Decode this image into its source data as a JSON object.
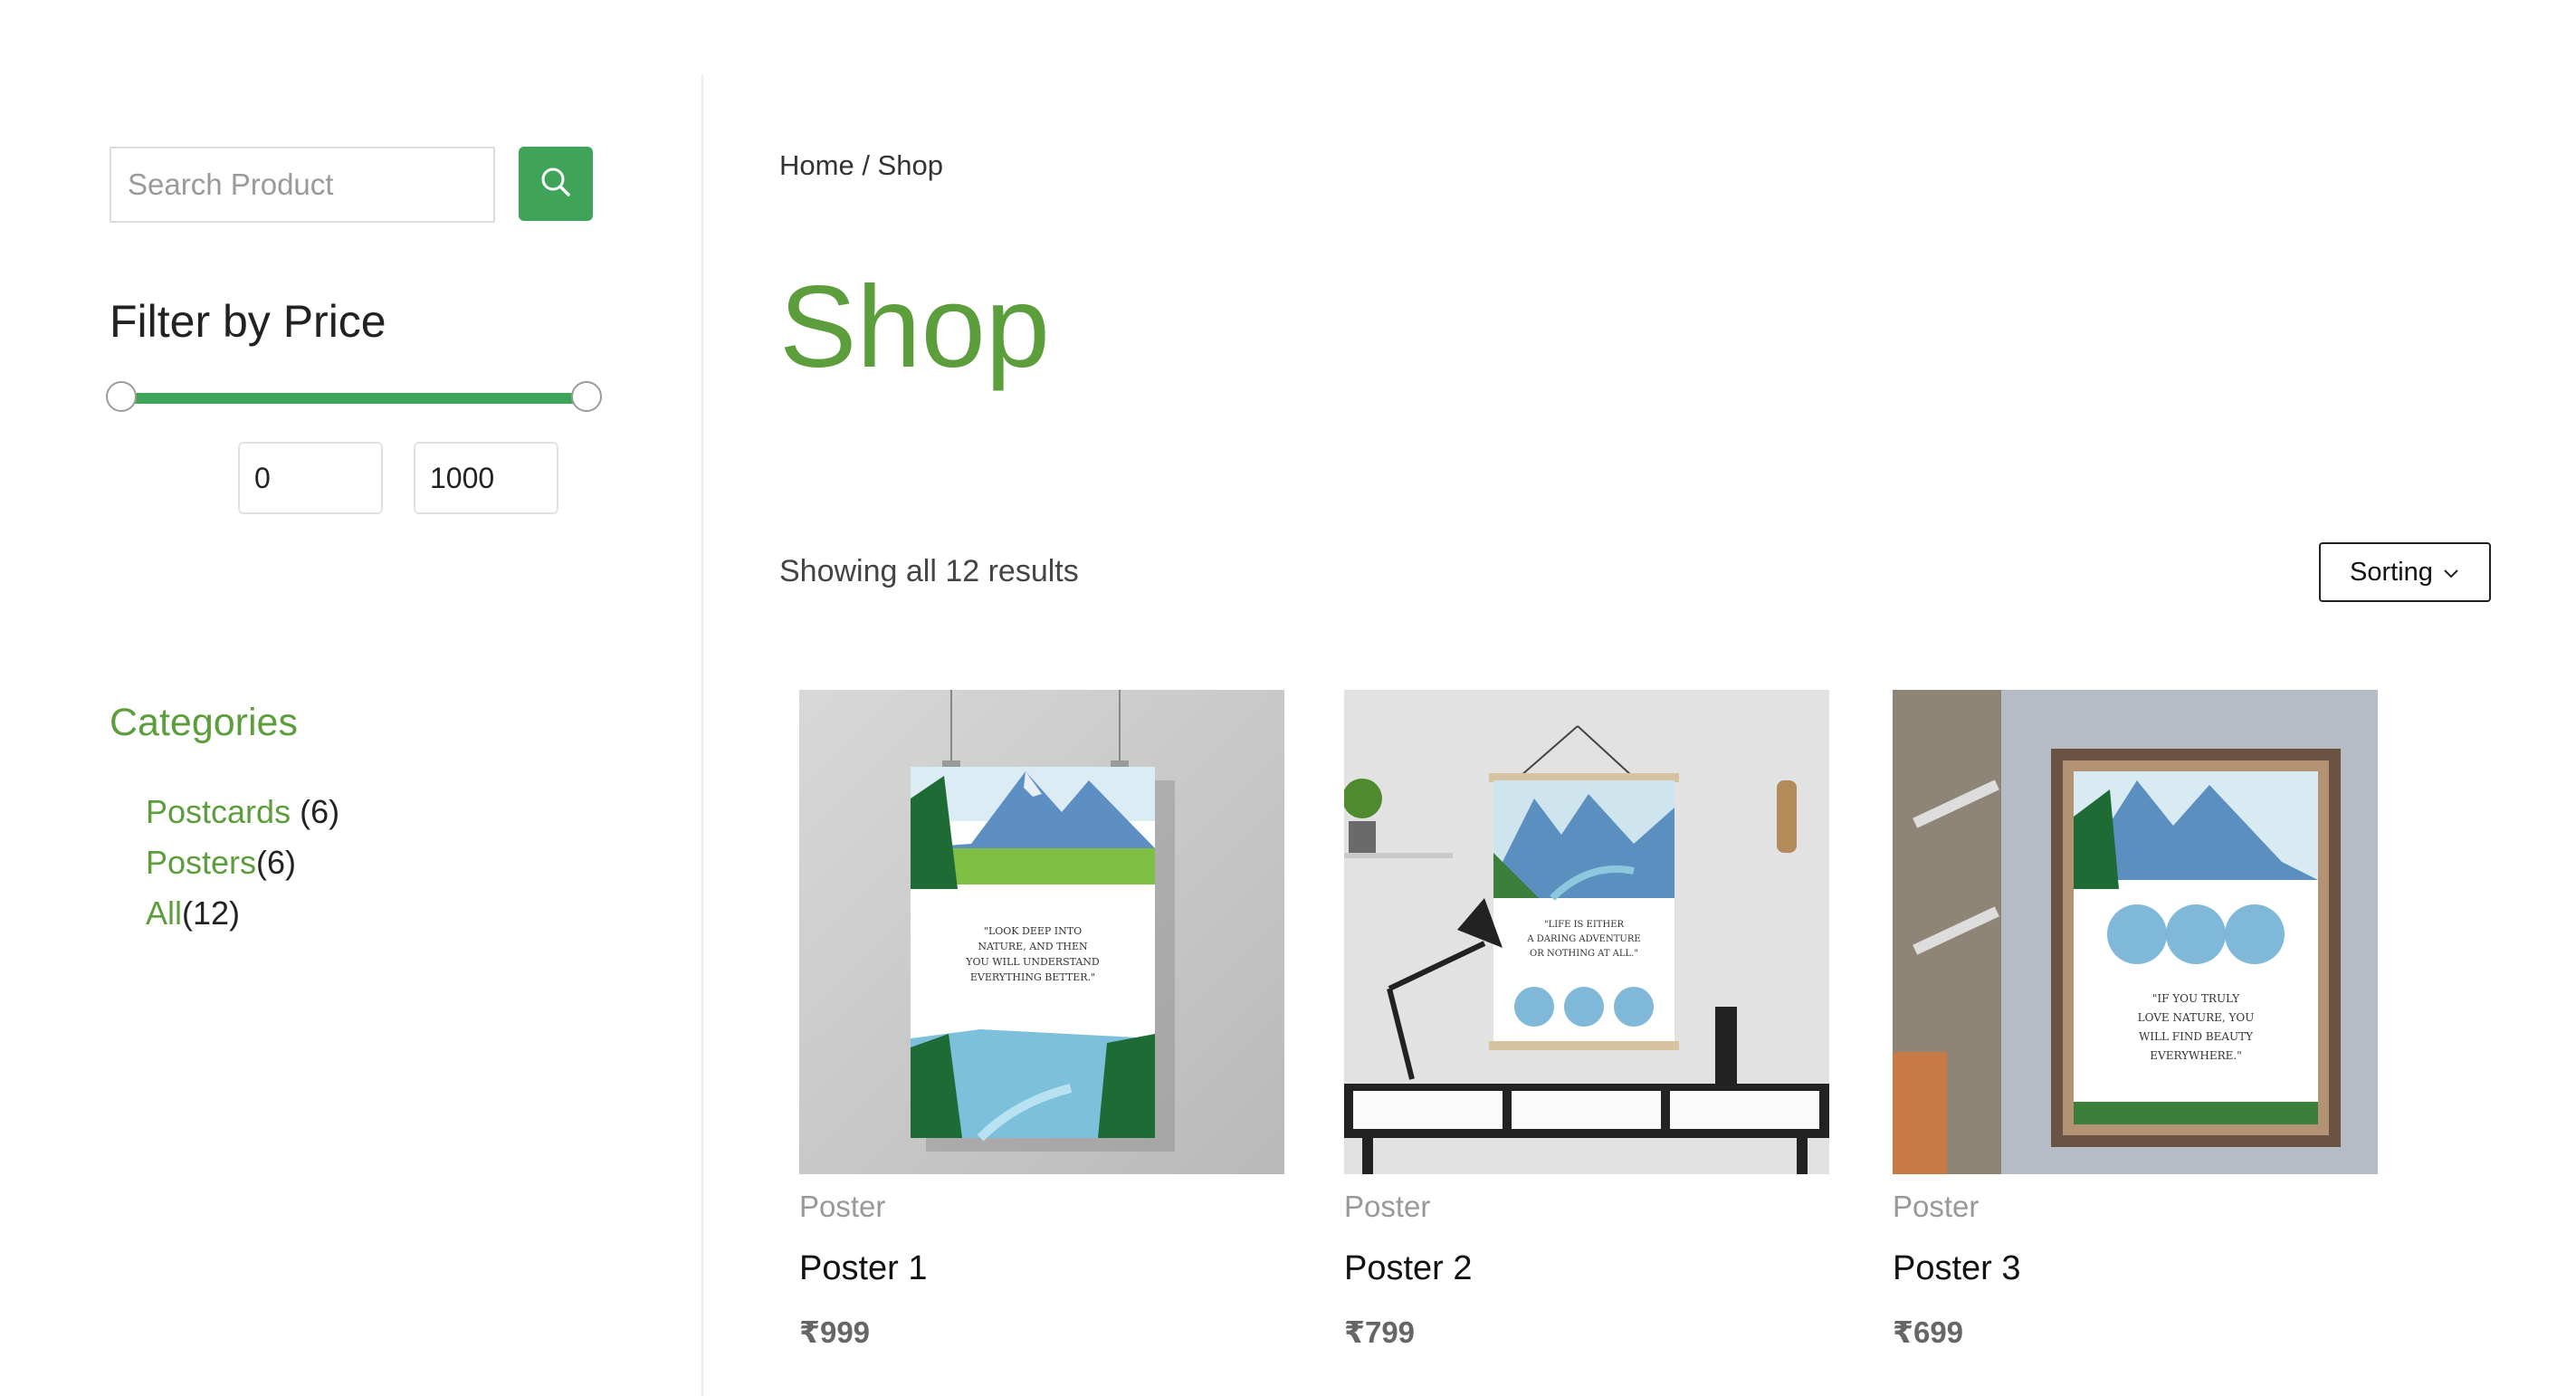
{
  "sidebar": {
    "search": {
      "placeholder": "Search Product",
      "value": ""
    },
    "filter": {
      "title": "Filter by Price",
      "min_value": "0",
      "max_value": "1000",
      "range_fraction": [
        0,
        1
      ]
    },
    "categories": {
      "title": "Categories",
      "items": [
        {
          "name": "Postcards",
          "count": " (6)"
        },
        {
          "name": "Posters",
          "count": "(6)"
        },
        {
          "name": "All",
          "count": "(12)"
        }
      ]
    }
  },
  "main": {
    "breadcrumb": {
      "home": "Home",
      "separator": " / ",
      "current": "Shop"
    },
    "title": "Shop",
    "result_count": "Showing all 12 results",
    "sorting_label": "Sorting",
    "products": [
      {
        "category": "Poster",
        "name": "Poster 1",
        "price": "₹999"
      },
      {
        "category": "Poster",
        "name": "Poster 2",
        "price": "₹799"
      },
      {
        "category": "Poster",
        "name": "Poster 3",
        "price": "₹699"
      }
    ]
  },
  "colors": {
    "accent_green": "#3fa35a",
    "title_green": "#5c9d3c"
  },
  "icons": [
    "search-icon",
    "chevron-down-icon"
  ]
}
